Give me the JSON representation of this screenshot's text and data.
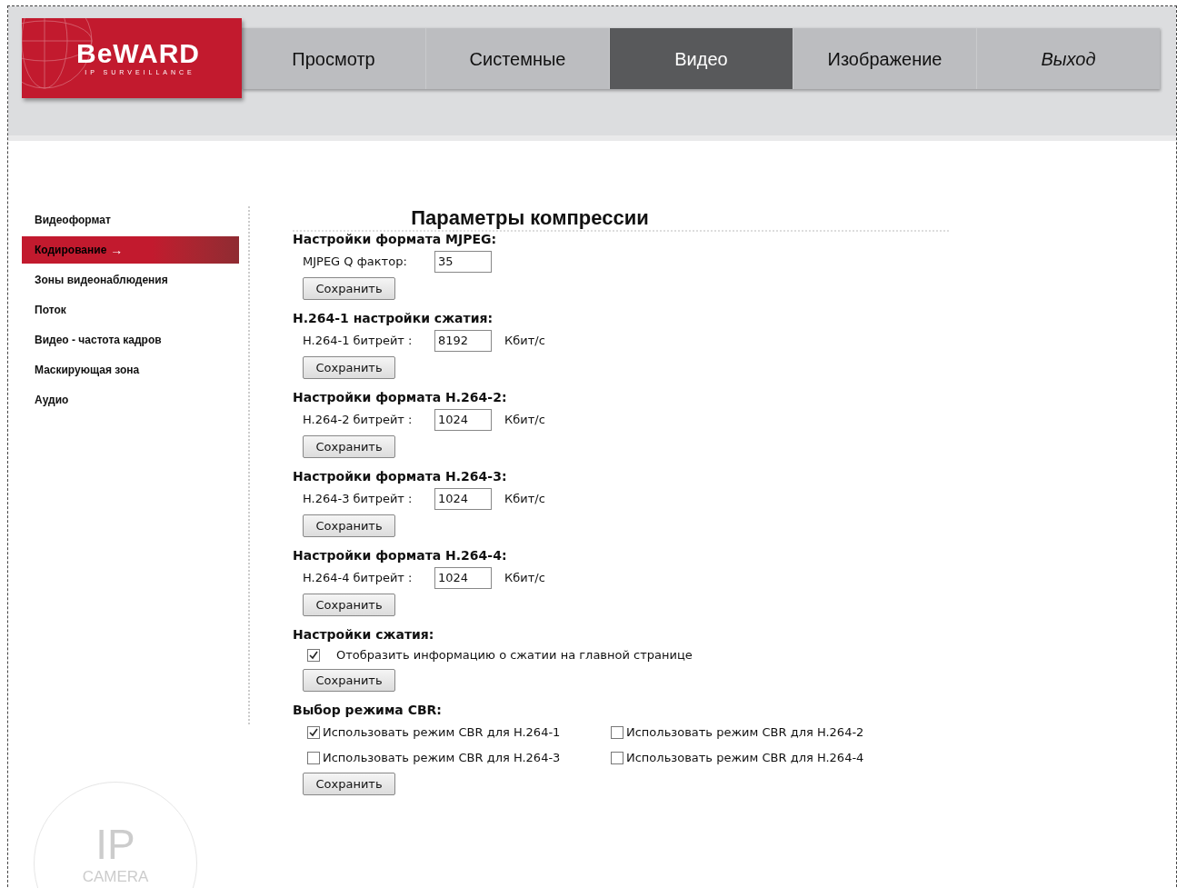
{
  "logo": {
    "brand": "BeWARD",
    "tagline": "IP SURVEILLANCE"
  },
  "tabs": [
    {
      "label": "Просмотр",
      "selected": false,
      "italic": false
    },
    {
      "label": "Системные",
      "selected": false,
      "italic": false
    },
    {
      "label": "Видео",
      "selected": true,
      "italic": false
    },
    {
      "label": "Изображение",
      "selected": false,
      "italic": false
    },
    {
      "label": "Выход",
      "selected": false,
      "italic": true
    }
  ],
  "sidebar": {
    "items": [
      {
        "label": "Видеоформат",
        "selected": false
      },
      {
        "label": "Кодирование",
        "selected": true,
        "arrow": "→"
      },
      {
        "label": "Зоны видеонаблюдения",
        "selected": false
      },
      {
        "label": "Поток",
        "selected": false
      },
      {
        "label": "Видео - частота кадров",
        "selected": false
      },
      {
        "label": "Маскирующая зона",
        "selected": false
      },
      {
        "label": "Аудио",
        "selected": false
      }
    ]
  },
  "bottom_logo": {
    "line_1": "IP",
    "line_2": "CAMERA"
  },
  "title": "Параметры компрессии",
  "sections": [
    {
      "title": "Настройки формата MJPEG:",
      "rows": [
        {
          "kind": "input",
          "label": "MJPEG Q фактор:",
          "value": "35"
        }
      ],
      "button": "Сохранить"
    },
    {
      "title": "H.264-1 настройки сжатия:",
      "rows": [
        {
          "kind": "input",
          "label": "H.264-1 битрейт :",
          "value": "8192",
          "unit": "Кбит/с"
        }
      ],
      "button": "Сохранить"
    },
    {
      "title": "Настройки формата H.264-2:",
      "rows": [
        {
          "kind": "input",
          "label": "H.264-2 битрейт :",
          "value": "1024",
          "unit": "Кбит/с"
        }
      ],
      "button": "Сохранить"
    },
    {
      "title": "Настройки формата H.264-3:",
      "rows": [
        {
          "kind": "input",
          "label": "H.264-3 битрейт :",
          "value": "1024",
          "unit": "Кбит/с"
        }
      ],
      "button": "Сохранить"
    },
    {
      "title": "Настройки формата H.264-4:",
      "rows": [
        {
          "kind": "input",
          "label": "H.264-4 битрейт :",
          "value": "1024",
          "unit": "Кбит/с"
        }
      ],
      "button": "Сохранить"
    },
    {
      "title": "Настройки сжатия:",
      "rows": [
        {
          "kind": "checkbox",
          "label": "Отобразить информацию о сжатии на главной странице",
          "checked": true
        }
      ],
      "button": "Сохранить"
    },
    {
      "title": "Выбор режима CBR:",
      "rows": [
        {
          "kind": "checkbox_grid",
          "items": [
            {
              "label": "Использовать режим CBR для H.264-1",
              "checked": true
            },
            {
              "label": "Использовать режим CBR для H.264-2",
              "checked": false
            },
            {
              "label": "Использовать режим CBR для H.264-3",
              "checked": false
            },
            {
              "label": "Использовать режим CBR для H.264-4",
              "checked": false
            }
          ]
        }
      ],
      "button": "Сохранить"
    }
  ]
}
